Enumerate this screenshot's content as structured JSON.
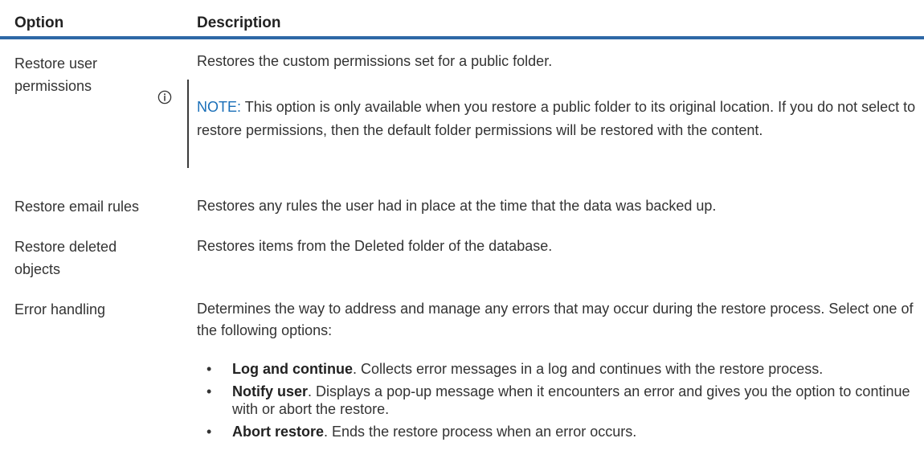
{
  "table": {
    "headers": {
      "option": "Option",
      "description": "Description"
    },
    "rows": [
      {
        "option": "Restore user permissions",
        "option_line1": "Restore user",
        "option_line2": "permissions",
        "description": "Restores the custom permissions set for a public folder.",
        "note": {
          "label": "NOTE:",
          "text": "This option is only available when you restore a public folder to its original location. If you do not select to restore permissions, then the default folder permissions will be restored with the content."
        }
      },
      {
        "option": "Restore email rules",
        "description": "Restores any rules the user had in place at the time that the data was backed up."
      },
      {
        "option": "Restore deleted objects",
        "option_line1": "Restore deleted",
        "option_line2": "objects",
        "description": "Restores items from the Deleted folder of the database."
      },
      {
        "option": "Error handling",
        "description": "Determines the way to address and manage any errors that may occur during the restore process. Select one of the following options:",
        "bullets": [
          {
            "label": "Log and continue",
            "text": ". Collects error messages in a log and continues with the restore process."
          },
          {
            "label": "Notify user",
            "text": ". Displays a pop-up message when it encounters an error and gives you the option to continue with or abort the restore."
          },
          {
            "label": "Abort restore",
            "text": ". Ends the restore process when an error occurs."
          }
        ]
      }
    ]
  },
  "icons": {
    "note_icon": "info-circle-icon"
  },
  "colors": {
    "header_rule": "#2e68a6",
    "note_label": "#1a6fb8"
  }
}
